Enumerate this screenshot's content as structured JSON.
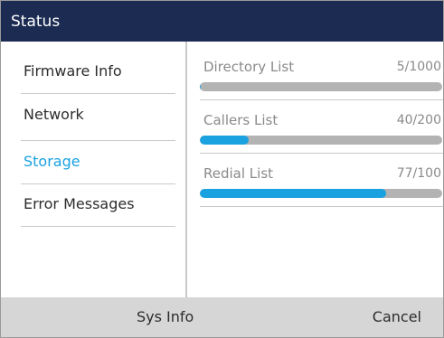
{
  "title_bar": {
    "title": "Status"
  },
  "sidebar": {
    "items": [
      {
        "label": "Firmware Info",
        "active": false
      },
      {
        "label": "Network",
        "active": false
      },
      {
        "label": "Storage",
        "active": true
      },
      {
        "label": "Error Messages",
        "active": false
      }
    ]
  },
  "storage": {
    "lists": [
      {
        "label": "Directory List",
        "used_text": "5/1000",
        "used": 5,
        "capacity": 1000
      },
      {
        "label": "Callers List",
        "used_text": "40/200",
        "used": 40,
        "capacity": 200
      },
      {
        "label": "Redial List",
        "used_text": "77/100",
        "used": 77,
        "capacity": 100
      }
    ]
  },
  "softkeys": {
    "sys_info": "Sys Info",
    "cancel": "Cancel"
  },
  "colors": {
    "title_bar_bg": "#1b2b52",
    "accent": "#1aa1e0",
    "progress_track": "#b3b3b3",
    "softkey_bar_bg": "#d6d6d6"
  }
}
